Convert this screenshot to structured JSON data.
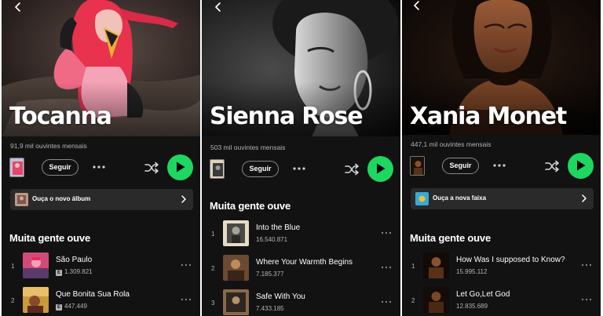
{
  "panels": [
    {
      "artist_name": "Tocanna",
      "monthly_listeners": "91,9 mil ouvintes mensais",
      "follow_label": "Seguir",
      "promo_label": "Ouça o novo álbum",
      "section_title": "Muita gente ouve",
      "tracks": [
        {
          "num": "1",
          "title": "São Paulo",
          "plays": "1.309.821",
          "explicit": "E"
        },
        {
          "num": "2",
          "title": "Que Bonita Sua Rola",
          "plays": "447.449",
          "explicit": "E"
        }
      ]
    },
    {
      "artist_name": "Sienna Rose",
      "monthly_listeners": "503 mil ouvintes mensais",
      "follow_label": "Seguir",
      "section_title": "Muita gente ouve",
      "tracks": [
        {
          "num": "1",
          "title": "Into the Blue",
          "plays": "16.540.871"
        },
        {
          "num": "2",
          "title": "Where Your Warmth Begins",
          "plays": "7.185.377"
        },
        {
          "num": "3",
          "title": "Safe With You",
          "plays": "7.433.185"
        }
      ]
    },
    {
      "artist_name": "Xania Monet",
      "monthly_listeners": "447,1 mil ouvintes mensais",
      "follow_label": "Seguir",
      "promo_label": "Ouça a nova faixa",
      "section_title": "Muita gente ouve",
      "tracks": [
        {
          "num": "1",
          "title": "How Was I supposed to Know?",
          "plays": "15.995.112"
        },
        {
          "num": "2",
          "title": "Let Go,Let God",
          "plays": "12.835.689"
        }
      ]
    }
  ],
  "colors": {
    "background": "#121212",
    "accent_green": "#1ed760",
    "secondary_text": "#b3b3b3",
    "promo_bg": "#2a2a2a"
  },
  "icons": [
    "back-icon",
    "more-icon",
    "shuffle-icon",
    "play-icon",
    "chevron-right-icon"
  ]
}
